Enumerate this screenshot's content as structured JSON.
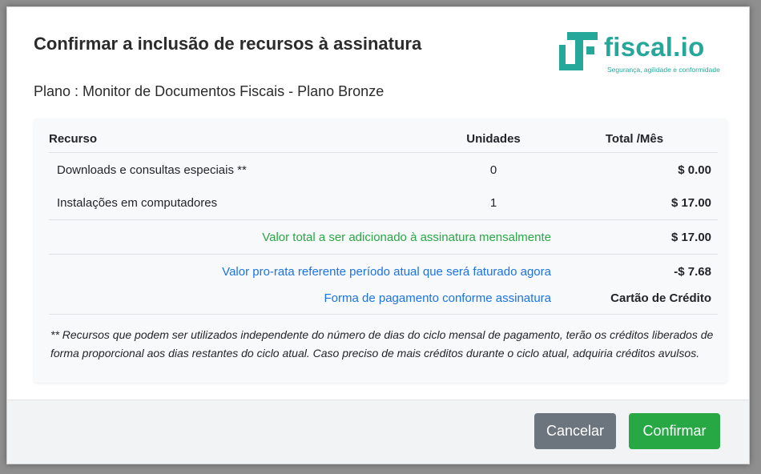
{
  "modal": {
    "title": "Confirmar a inclusão de recursos à assinatura",
    "plan": "Plano : Monitor de Documentos Fiscais - Plano Bronze"
  },
  "logo": {
    "name": "fiscal.io",
    "tagline": "Segurança, agilidade e conformidade",
    "color": "#25a89a"
  },
  "table": {
    "headers": {
      "recurso": "Recurso",
      "unidades": "Unidades",
      "total": "Total /Mês"
    },
    "rows": [
      {
        "name": "Downloads e consultas especiais **",
        "units": "0",
        "total": "$ 0.00"
      },
      {
        "name": "Instalações em computadores",
        "units": "1",
        "total": "$ 17.00"
      }
    ]
  },
  "summary": {
    "total_label": "Valor total a ser adicionado à assinatura mensalmente",
    "total_value": "$ 17.00",
    "prorata_label": "Valor pro-rata referente período atual que será faturado agora",
    "prorata_value": "-$ 7.68",
    "payment_label": "Forma de pagamento conforme assinatura",
    "payment_value": "Cartão de Crédito"
  },
  "note": "** Recursos que podem ser utilizados independente do número de dias do ciclo mensal de pagamento, terão os créditos liberados de forma proporcional aos dias restantes do ciclo atual. Caso preciso de mais créditos durante o ciclo atual, adquiria créditos avulsos.",
  "buttons": {
    "cancel": "Cancelar",
    "confirm": "Confirmar"
  },
  "colors": {
    "green": "#28a745",
    "blue": "#1a73e8",
    "cancel_bg": "#6c757d"
  }
}
